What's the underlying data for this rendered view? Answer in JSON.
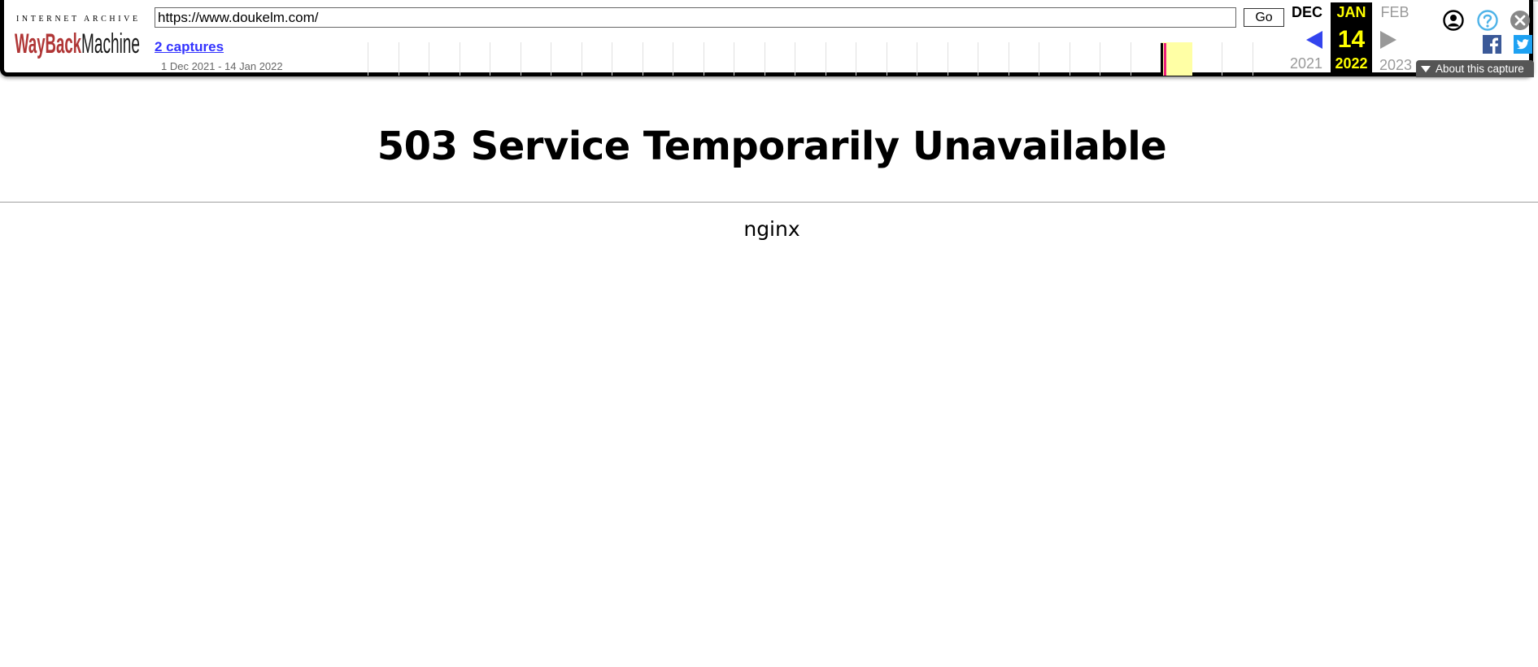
{
  "toolbar": {
    "logo_top": "INTERNET ARCHIVE",
    "logo_wayback": "WayBack",
    "logo_machine": "Machine",
    "url": "https://www.doukelm.com/",
    "go_label": "Go",
    "captures_label": "2 captures",
    "captures_range": "1 Dec 2021 - 14 Jan 2022",
    "calendar": {
      "prev_month": "DEC",
      "current_month": "JAN",
      "current_day": "14",
      "current_year": "2022",
      "next_month": "FEB",
      "prev_year": "2021",
      "next_year": "2023"
    },
    "about_label": "About this capture",
    "icons": {
      "account": "account-icon",
      "help": "help-icon",
      "close": "close-icon",
      "facebook": "facebook-icon",
      "twitter": "twitter-icon",
      "prev": "arrow-left-icon",
      "next": "arrow-right-icon"
    },
    "colors": {
      "logo_red": "#b03636",
      "link_blue": "#3333ff",
      "highlight_year": "#ffff00",
      "sparkline_highlight": "#ffffa5",
      "capture_mark": "#ee1f7b",
      "help_blue": "#4fb3e8",
      "facebook_blue": "#3b5998",
      "twitter_blue": "#1da1f2"
    }
  },
  "page": {
    "title": "503 Service Temporarily Unavailable",
    "server": "nginx"
  }
}
